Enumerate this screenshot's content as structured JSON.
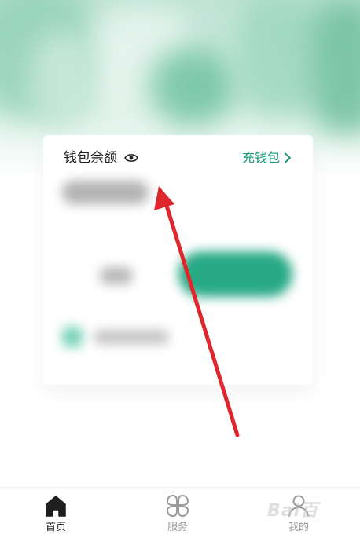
{
  "wallet": {
    "title": "钱包余额",
    "recharge_label": "充钱包"
  },
  "icons": {
    "balance_visibility": "eye-icon",
    "recharge_arrow": "chevron-right-icon"
  },
  "annotation": {
    "arrow_color": "#e0262d"
  },
  "colors": {
    "accent": "#179a77",
    "hero": "#8fd0b5"
  },
  "tabbar": {
    "items": [
      {
        "label": "首页",
        "icon": "home-icon",
        "active": true
      },
      {
        "label": "服务",
        "icon": "grid-icon",
        "active": false
      },
      {
        "label": "我的",
        "icon": "user-icon",
        "active": false
      }
    ]
  },
  "watermark": {
    "text": "Bai百"
  }
}
